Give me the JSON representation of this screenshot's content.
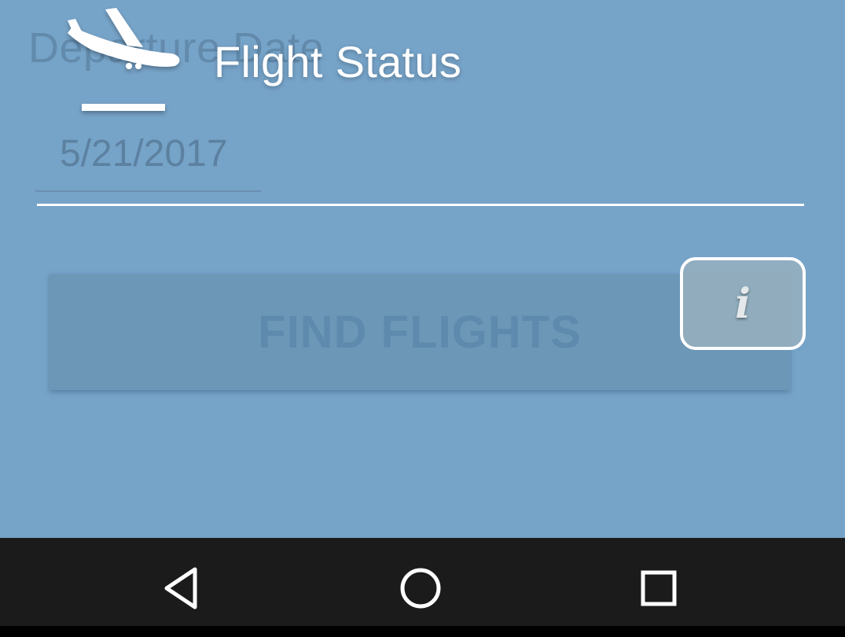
{
  "form": {
    "departure_label": "Departure Date",
    "departure_value": "5/21/2017",
    "find_button_label": "FIND FLIGHTS"
  },
  "overlay": {
    "title": "Flight Status",
    "icon": "plane-landing-icon",
    "info_button_glyph": "i"
  },
  "navigation": {
    "back_icon": "back-triangle-icon",
    "home_icon": "home-circle-icon",
    "recents_icon": "recents-square-icon"
  },
  "colors": {
    "background": "#76a3c8",
    "overlay_text": "#ffffff",
    "navbar": "#1b1b1b"
  }
}
